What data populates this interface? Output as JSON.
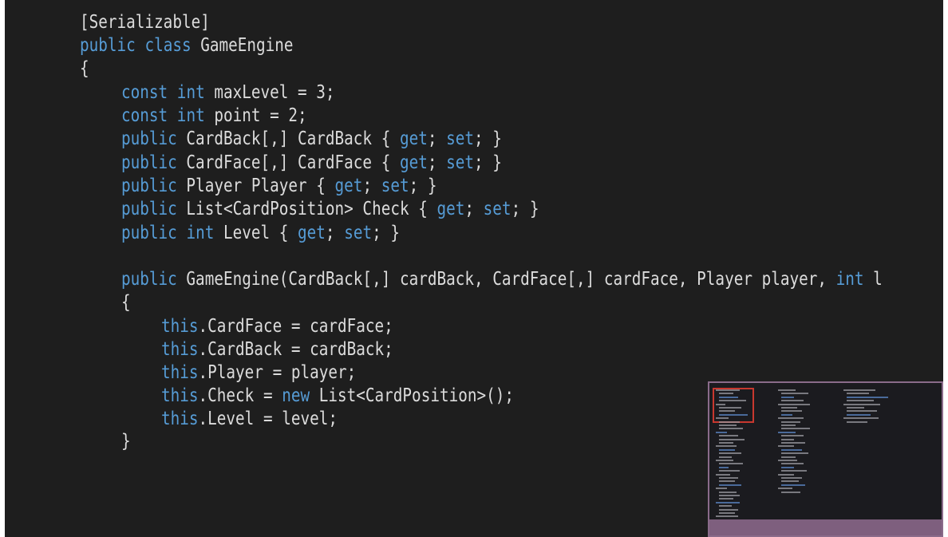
{
  "editor": {
    "background": "#1e1e1e",
    "keyword_color": "#569cd6",
    "text_color": "#dcdcdc",
    "lines": [
      {
        "id": "line-attribute",
        "tokens": [
          {
            "t": "[Serializable]",
            "k": "plain"
          }
        ]
      },
      {
        "id": "line-class-decl",
        "tokens": [
          {
            "t": "public",
            "k": "kw"
          },
          {
            "t": " ",
            "k": "plain"
          },
          {
            "t": "class",
            "k": "kw"
          },
          {
            "t": " GameEngine",
            "k": "plain"
          }
        ]
      },
      {
        "id": "line-class-open",
        "tokens": [
          {
            "t": "{",
            "k": "plain"
          }
        ]
      },
      {
        "id": "line-const-maxlevel",
        "tokens": [
          {
            "t": "const",
            "k": "kw"
          },
          {
            "t": " ",
            "k": "plain"
          },
          {
            "t": "int",
            "k": "kw"
          },
          {
            "t": " maxLevel = 3;",
            "k": "plain"
          }
        ]
      },
      {
        "id": "line-const-point",
        "tokens": [
          {
            "t": "const",
            "k": "kw"
          },
          {
            "t": " ",
            "k": "plain"
          },
          {
            "t": "int",
            "k": "kw"
          },
          {
            "t": " point = 2;",
            "k": "plain"
          }
        ]
      },
      {
        "id": "line-prop-cardback",
        "tokens": [
          {
            "t": "public",
            "k": "kw"
          },
          {
            "t": " CardBack[,] CardBack { ",
            "k": "plain"
          },
          {
            "t": "get",
            "k": "ctx"
          },
          {
            "t": "; ",
            "k": "plain"
          },
          {
            "t": "set",
            "k": "ctx"
          },
          {
            "t": "; }",
            "k": "plain"
          }
        ]
      },
      {
        "id": "line-prop-cardface",
        "tokens": [
          {
            "t": "public",
            "k": "kw"
          },
          {
            "t": " CardFace[,] CardFace { ",
            "k": "plain"
          },
          {
            "t": "get",
            "k": "ctx"
          },
          {
            "t": "; ",
            "k": "plain"
          },
          {
            "t": "set",
            "k": "ctx"
          },
          {
            "t": "; }",
            "k": "plain"
          }
        ]
      },
      {
        "id": "line-prop-player",
        "tokens": [
          {
            "t": "public",
            "k": "kw"
          },
          {
            "t": " Player Player { ",
            "k": "plain"
          },
          {
            "t": "get",
            "k": "ctx"
          },
          {
            "t": "; ",
            "k": "plain"
          },
          {
            "t": "set",
            "k": "ctx"
          },
          {
            "t": "; }",
            "k": "plain"
          }
        ]
      },
      {
        "id": "line-prop-check",
        "tokens": [
          {
            "t": "public",
            "k": "kw"
          },
          {
            "t": " List<CardPosition> Check { ",
            "k": "plain"
          },
          {
            "t": "get",
            "k": "ctx"
          },
          {
            "t": "; ",
            "k": "plain"
          },
          {
            "t": "set",
            "k": "ctx"
          },
          {
            "t": "; }",
            "k": "plain"
          }
        ]
      },
      {
        "id": "line-prop-level",
        "tokens": [
          {
            "t": "public",
            "k": "kw"
          },
          {
            "t": " ",
            "k": "plain"
          },
          {
            "t": "int",
            "k": "kw"
          },
          {
            "t": " Level { ",
            "k": "plain"
          },
          {
            "t": "get",
            "k": "ctx"
          },
          {
            "t": "; ",
            "k": "plain"
          },
          {
            "t": "set",
            "k": "ctx"
          },
          {
            "t": "; }",
            "k": "plain"
          }
        ]
      },
      {
        "id": "line-blank",
        "tokens": []
      },
      {
        "id": "line-ctor-decl",
        "tokens": [
          {
            "t": "public",
            "k": "kw"
          },
          {
            "t": " GameEngine(CardBack[,] cardBack, CardFace[,] cardFace, Player player, ",
            "k": "plain"
          },
          {
            "t": "int",
            "k": "kw"
          },
          {
            "t": " l",
            "k": "plain"
          }
        ]
      },
      {
        "id": "line-ctor-open",
        "tokens": [
          {
            "t": "{",
            "k": "plain"
          }
        ]
      },
      {
        "id": "line-assign-cardface",
        "tokens": [
          {
            "t": "this",
            "k": "kw"
          },
          {
            "t": ".CardFace = cardFace;",
            "k": "plain"
          }
        ]
      },
      {
        "id": "line-assign-cardback",
        "tokens": [
          {
            "t": "this",
            "k": "kw"
          },
          {
            "t": ".CardBack = cardBack;",
            "k": "plain"
          }
        ]
      },
      {
        "id": "line-assign-player",
        "tokens": [
          {
            "t": "this",
            "k": "kw"
          },
          {
            "t": ".Player = player;",
            "k": "plain"
          }
        ]
      },
      {
        "id": "line-assign-check",
        "tokens": [
          {
            "t": "this",
            "k": "kw"
          },
          {
            "t": ".Check = ",
            "k": "plain"
          },
          {
            "t": "new",
            "k": "kw"
          },
          {
            "t": " List<CardPosition>();",
            "k": "plain"
          }
        ]
      },
      {
        "id": "line-assign-level",
        "tokens": [
          {
            "t": "this",
            "k": "kw"
          },
          {
            "t": ".Level = level;",
            "k": "plain"
          }
        ]
      },
      {
        "id": "line-ctor-close",
        "tokens": [
          {
            "t": "}",
            "k": "plain"
          }
        ]
      }
    ]
  },
  "minimap": {
    "background": "#1b1b1f",
    "frame_color": "#8a6b8a",
    "highlight_color": "#c8382f"
  }
}
